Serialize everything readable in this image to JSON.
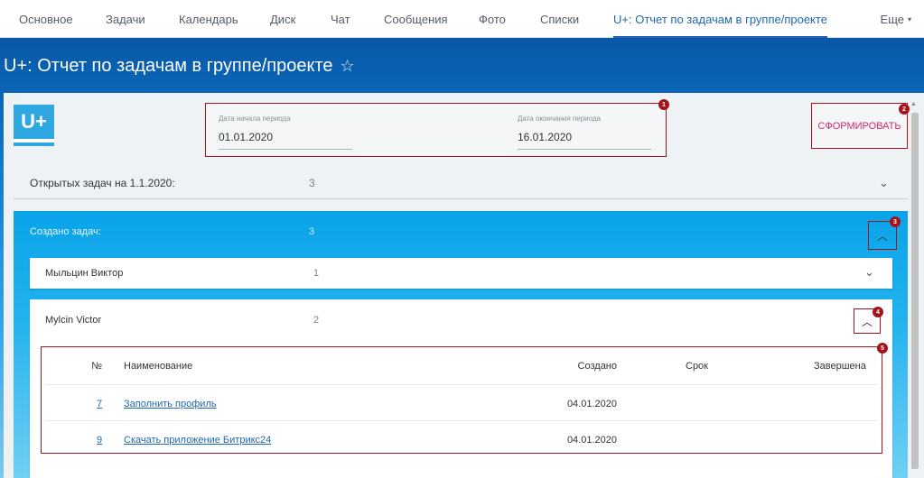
{
  "nav": {
    "items": [
      {
        "label": "Основное",
        "active": false
      },
      {
        "label": "Задачи",
        "active": false
      },
      {
        "label": "Календарь",
        "active": false
      },
      {
        "label": "Диск",
        "active": false
      },
      {
        "label": "Чат",
        "active": false
      },
      {
        "label": "Сообщения",
        "active": false
      },
      {
        "label": "Фото",
        "active": false
      },
      {
        "label": "Списки",
        "active": false
      },
      {
        "label": "U+: Отчет по задачам в группе/проекте",
        "active": true
      }
    ],
    "more_label": "Еще"
  },
  "page": {
    "title": "U+: Отчет по задачам в группе/проекте",
    "star_icon": "star-outline-icon"
  },
  "logo_text": "U+",
  "period": {
    "start_label": "Дата начала периода",
    "start_value": "01.01.2020",
    "end_label": "Дата окончания периода",
    "end_value": "16.01.2020"
  },
  "generate_button": "СФОРМИРОВАТЬ",
  "badges": [
    "1",
    "2",
    "3",
    "4",
    "5"
  ],
  "open_tasks": {
    "label": "Открытых задач на 1.1.2020:",
    "count": "3"
  },
  "created": {
    "label": "Создано задач:",
    "count": "3",
    "people": [
      {
        "name": "Мыльцин Виктор",
        "count": "1",
        "expanded": false
      },
      {
        "name": "Mylcin Victor",
        "count": "2",
        "expanded": true
      }
    ]
  },
  "tasks": {
    "columns": [
      "№",
      "Наименование",
      "Создано",
      "Срок",
      "Завершена"
    ],
    "rows": [
      {
        "num": "7",
        "name": "Заполнить профиль",
        "created": "04.01.2020",
        "deadline": "",
        "done": ""
      },
      {
        "num": "9",
        "name": "Скачать приложение Битрикс24",
        "created": "04.01.2020",
        "deadline": "",
        "done": ""
      }
    ]
  },
  "colors": {
    "accent": "#2067b0",
    "highlight_border": "#a4131b",
    "button_text": "#d6286e",
    "created_block": "#0aa3e8"
  }
}
